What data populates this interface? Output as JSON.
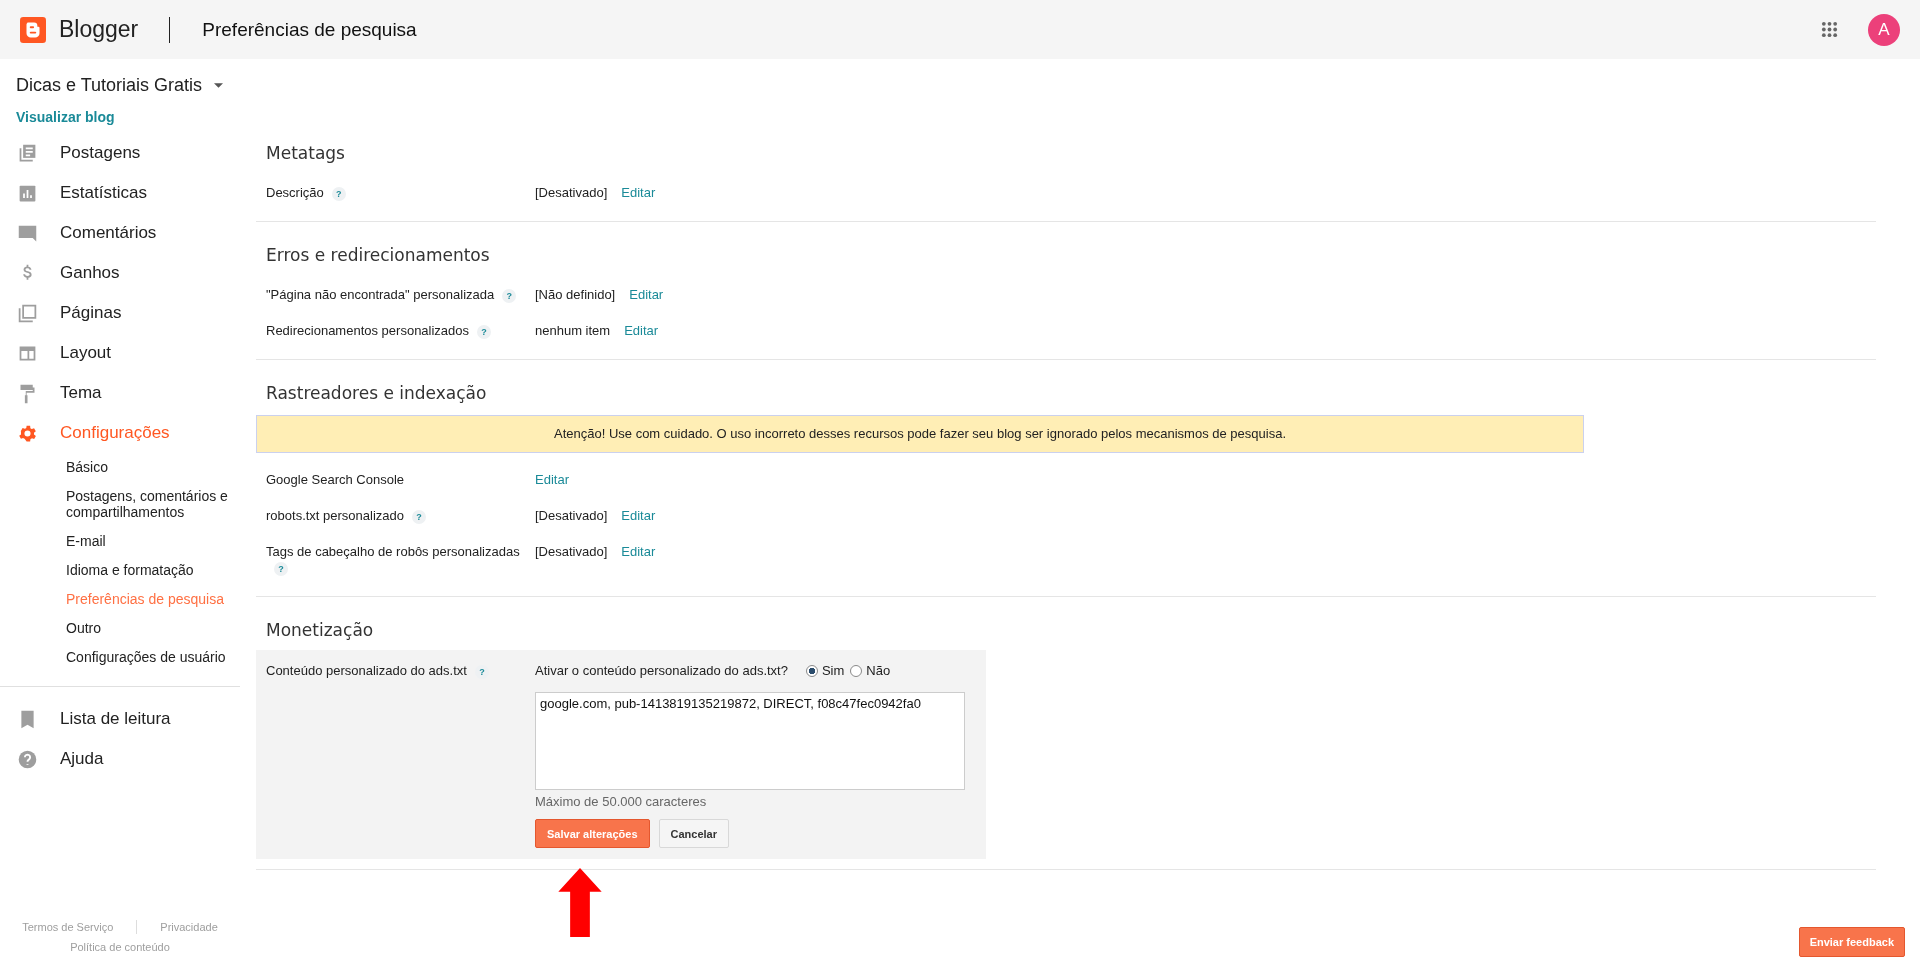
{
  "header": {
    "logo_text": "Blogger",
    "page_title": "Preferências de pesquisa",
    "avatar_letter": "A"
  },
  "sidebar": {
    "blog_name": "Dicas e Tutoriais Gratis",
    "view_blog_link": "Visualizar blog",
    "nav": [
      {
        "label": "Postagens",
        "kind": "posts",
        "selected": false
      },
      {
        "label": "Estatísticas",
        "kind": "stats",
        "selected": false
      },
      {
        "label": "Comentários",
        "kind": "comments",
        "selected": false
      },
      {
        "label": "Ganhos",
        "kind": "earnings",
        "selected": false
      },
      {
        "label": "Páginas",
        "kind": "pages",
        "selected": false
      },
      {
        "label": "Layout",
        "kind": "layout",
        "selected": false
      },
      {
        "label": "Tema",
        "kind": "theme",
        "selected": false
      },
      {
        "label": "Configurações",
        "kind": "settings",
        "selected": true,
        "children": [
          {
            "label": "Básico",
            "selected": false
          },
          {
            "label": "Postagens, comentários e compartilhamentos",
            "selected": false
          },
          {
            "label": "E-mail",
            "selected": false
          },
          {
            "label": "Idioma e formatação",
            "selected": false
          },
          {
            "label": "Preferências de pesquisa",
            "selected": true
          },
          {
            "label": "Outro",
            "selected": false
          },
          {
            "label": "Configurações de usuário",
            "selected": false
          }
        ]
      }
    ],
    "secondary_nav": [
      {
        "label": "Lista de leitura",
        "kind": "bookmark"
      },
      {
        "label": "Ajuda",
        "kind": "help"
      }
    ],
    "footer_links": [
      "Termos de Serviço",
      "Privacidade",
      "Política de conteúdo"
    ]
  },
  "sections": [
    {
      "kind": "settings",
      "title": "Metatags",
      "rows": [
        {
          "label": "Descrição",
          "help_mark": "?",
          "value": "[Desativado]",
          "action": "Editar"
        }
      ]
    },
    {
      "kind": "settings",
      "title": "Erros e redirecionamentos",
      "rows": [
        {
          "label": "\"Página não encontrada\" personalizada",
          "help_mark": "?",
          "value": "[Não definido]",
          "action": "Editar"
        },
        {
          "label": "Redirecionamentos personalizados",
          "help_mark": "?",
          "value": "nenhum item",
          "action": "Editar"
        }
      ]
    },
    {
      "kind": "settings",
      "title": "Rastreadores e indexação",
      "warning": "Atenção! Use com cuidado. O uso incorreto desses recursos pode fazer seu blog ser ignorado pelos mecanismos de pesquisa.",
      "rows": [
        {
          "label": "Google Search Console",
          "action": "Editar"
        },
        {
          "label": "robots.txt personalizado",
          "help_mark": "?",
          "value": "[Desativado]",
          "action": "Editar"
        },
        {
          "label": "Tags de cabeçalho de robôs personalizadas",
          "help_mark": "?",
          "value": "[Desativado]",
          "action": "Editar"
        }
      ]
    },
    {
      "kind": "ads",
      "title": "Monetização",
      "label": "Conteúdo personalizado do ads.txt",
      "help_mark": "?",
      "question": "Ativar o conteúdo personalizado do ads.txt?",
      "options": [
        {
          "label": "Sim",
          "selected": true
        },
        {
          "label": "Não",
          "selected": false
        }
      ],
      "content": "google.com, pub-1413819135219872, DIRECT, f08c47fec0942fa0",
      "hint": "Máximo de 50.000 caracteres",
      "buttons": [
        {
          "label": "Salvar alterações",
          "kind": "primary"
        },
        {
          "label": "Cancelar",
          "kind": "secondary"
        }
      ]
    }
  ],
  "feedback_button": "Enviar feedback"
}
